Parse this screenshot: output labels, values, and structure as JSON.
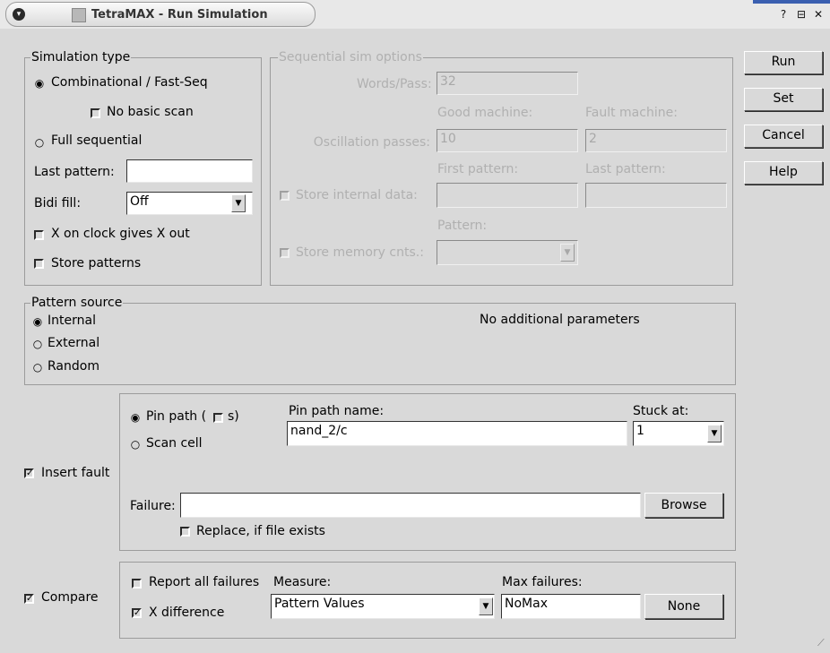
{
  "window": {
    "title": "TetraMAX - Run Simulation",
    "controls": {
      "help": "?",
      "maximize": "⊟",
      "close": "✕"
    }
  },
  "buttons": {
    "run": "Run",
    "set": "Set",
    "cancel": "Cancel",
    "help": "Help"
  },
  "simulation_type": {
    "legend": "Simulation type",
    "combinational": "Combinational / Fast-Seq",
    "no_basic_scan": "No basic scan",
    "full_sequential": "Full sequential",
    "last_pattern_label": "Last pattern:",
    "last_pattern_value": "",
    "bidi_fill_label": "Bidi fill:",
    "bidi_fill_value": "Off",
    "x_on_clock": "X on clock gives X out",
    "store_patterns": "Store patterns"
  },
  "sequential_options": {
    "legend": "Sequential sim options",
    "words_pass_label": "Words/Pass:",
    "words_pass_value": "32",
    "good_machine": "Good machine:",
    "fault_machine": "Fault machine:",
    "oscillation_label": "Oscillation passes:",
    "oscillation_good": "10",
    "oscillation_fault": "2",
    "first_pattern": "First pattern:",
    "last_pattern": "Last pattern:",
    "store_internal": "Store internal data:",
    "pattern": "Pattern:",
    "store_memory": "Store memory cnts.:"
  },
  "pattern_source": {
    "legend": "Pattern source",
    "internal": "Internal",
    "external": "External",
    "random": "Random",
    "note": "No additional parameters"
  },
  "insert_fault": {
    "label": "Insert fault",
    "pin_path": "Pin path (",
    "pin_path_s": "s)",
    "scan_cell": "Scan cell",
    "pin_path_name_label": "Pin path name:",
    "pin_path_name_value": "nand_2/c",
    "stuck_at_label": "Stuck at:",
    "stuck_at_value": "1",
    "failure_label": "Failure:",
    "failure_value": "",
    "browse": "Browse",
    "replace": "Replace, if file exists"
  },
  "compare": {
    "label": "Compare",
    "report_all": "Report all failures",
    "x_difference": "X difference",
    "measure_label": "Measure:",
    "measure_value": "Pattern Values",
    "max_failures_label": "Max failures:",
    "max_failures_value": "NoMax",
    "none_button": "None"
  }
}
